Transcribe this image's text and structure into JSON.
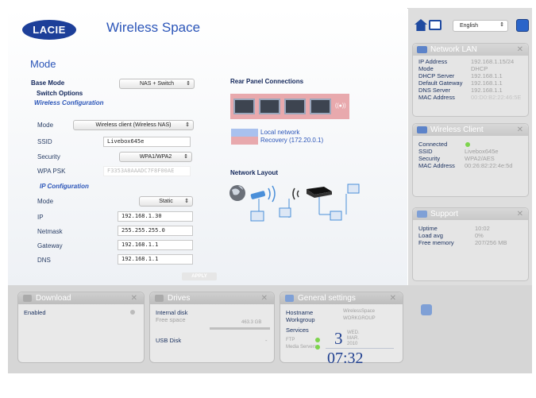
{
  "app": {
    "logo": "LACIE",
    "title": "Wireless Space"
  },
  "header": {
    "language": "English",
    "select_arrow": "⇕"
  },
  "mode": {
    "heading": "Mode",
    "base_mode_label": "Base Mode",
    "base_mode_value": "NAS + Switch",
    "switch_options": "Switch Options",
    "wireless_config": "Wireless Configuration",
    "mode_label": "Mode",
    "mode_value": "Wireless client (Wireless NAS)",
    "ssid_label": "SSID",
    "ssid_value": "Livebox645e",
    "security_label": "Security",
    "security_value": "WPA1/WPA2",
    "psk_label": "WPA PSK",
    "psk_value": "F3353A8AAADC7F8F00AE",
    "ip_config": "IP Configuration",
    "ip_mode_label": "Mode",
    "ip_mode_value": "Static",
    "ip_label": "IP",
    "ip_value": "192.168.1.30",
    "netmask_label": "Netmask",
    "netmask_value": "255.255.255.0",
    "gateway_label": "Gateway",
    "gateway_value": "192.168.1.1",
    "dns_label": "DNS",
    "dns_value": "192.168.1.1",
    "apply": "APPLY"
  },
  "rear": {
    "heading": "Rear Panel Connections",
    "wifi_icon": "((●))",
    "legend_local": "Local network",
    "legend_recovery": "Recovery (172.20.0.1)",
    "colors": {
      "local": "#a9c1ee",
      "recovery": "#e8a9ad"
    }
  },
  "layout": {
    "heading": "Network Layout"
  },
  "network_lan": {
    "title": "Network LAN",
    "rows": [
      {
        "k": "IP Address",
        "v": "192.168.1.15/24"
      },
      {
        "k": "Mode",
        "v": "DHCP"
      },
      {
        "k": "DHCP Server",
        "v": "192.168.1.1"
      },
      {
        "k": "Default Gateway",
        "v": "192.168.1.1"
      },
      {
        "k": "DNS Server",
        "v": "192.168.1.1"
      },
      {
        "k": "MAC Address",
        "v": "00:D0:B2:22:46:5E"
      }
    ]
  },
  "wireless_client": {
    "title": "Wireless Client",
    "rows": [
      {
        "k": "Connected",
        "v": ""
      },
      {
        "k": "SSID",
        "v": "Livebox645e"
      },
      {
        "k": "Security",
        "v": "WPA2/AES"
      },
      {
        "k": "MAC Address",
        "v": "00:26:82:22:4e:5d"
      }
    ]
  },
  "support": {
    "title": "Support",
    "rows": [
      {
        "k": "Uptime",
        "v": "10:02"
      },
      {
        "k": "Load avg",
        "v": "0%"
      },
      {
        "k": "Free memory",
        "v": "207/256 MB"
      }
    ]
  },
  "download": {
    "title": "Download",
    "enabled_label": "Enabled"
  },
  "drives": {
    "title": "Drives",
    "internal": "Internal disk",
    "free_space": "Free space",
    "free_value": "463.3 GB",
    "usb": "USB Disk",
    "usb_value": "-"
  },
  "general": {
    "title": "General settings",
    "hostname_label": "Hostname",
    "hostname_value": "WirelessSpace",
    "workgroup_label": "Workgroup",
    "workgroup_value": "WORKGROUP",
    "services_label": "Services",
    "ftp": "FTP",
    "media": "Media Servers",
    "day_num": "3",
    "day_name": "WED.",
    "month": "MAR.",
    "year": "2010",
    "time": "07:32"
  },
  "close_glyph": "✕"
}
